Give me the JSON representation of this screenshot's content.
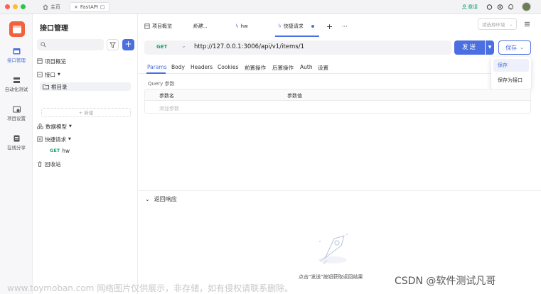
{
  "titlebar": {
    "home_tab": "主页",
    "fastapi_tab": "FastAPI",
    "invite_label": "邀请"
  },
  "rail": {
    "items": [
      {
        "label": "接口管理"
      },
      {
        "label": "自动化测试"
      },
      {
        "label": "项目设置"
      },
      {
        "label": "在线分享"
      }
    ]
  },
  "tree": {
    "title": "接口管理",
    "add_label": "+",
    "items": {
      "overview": "项目概览",
      "api": "接口",
      "root": "根目录",
      "new": "+ 新建",
      "models": "数据模型",
      "quick": "快捷请求",
      "hw_method": "GET",
      "hw_name": "hw",
      "trash": "回收站"
    }
  },
  "maintabs": {
    "tabs": [
      {
        "label": "项目概览"
      },
      {
        "label": "新建..."
      },
      {
        "label": "hw"
      },
      {
        "label": "快捷请求"
      }
    ],
    "add": "+",
    "more": "···",
    "env_placeholder": "请选择环境"
  },
  "request": {
    "method": "GET",
    "url": "http://127.0.0.1:3006/api/v1/items/1",
    "send_label": "发送",
    "save_label": "保存"
  },
  "save_menu": {
    "items": [
      "保存",
      "保存为接口"
    ]
  },
  "param_tabs": [
    "Params",
    "Body",
    "Headers",
    "Cookies",
    "前置操作",
    "后置操作",
    "Auth",
    "设置"
  ],
  "params": {
    "section_label": "Query 参数",
    "col_name": "参数名",
    "col_value": "参数值",
    "add_placeholder": "添加参数"
  },
  "response": {
    "title": "返回响应",
    "hint": "点击\"发送\"按钮获取返回结果"
  },
  "watermarks": {
    "left": "www.toymoban.com 网络图片仅供展示，非存储，如有侵权请联系删除。",
    "right": "CSDN @软件测试凡哥"
  },
  "colors": {
    "accent": "#4b6fe0",
    "get": "#1da36d",
    "logo": "#f0613d"
  }
}
